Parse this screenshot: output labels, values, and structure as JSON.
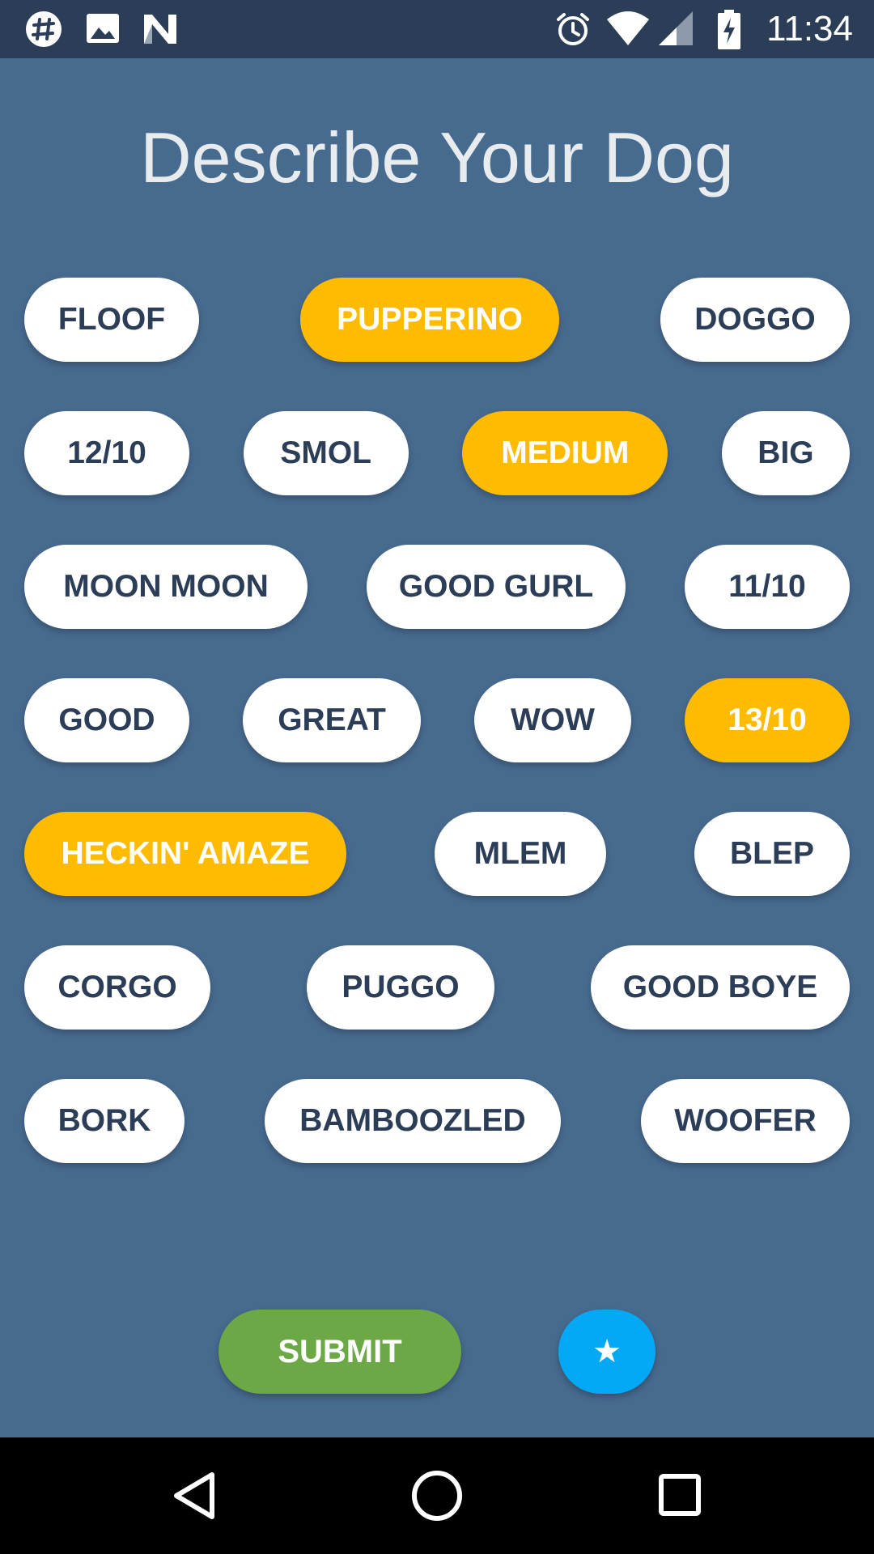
{
  "status_bar": {
    "time": "11:34",
    "left_icons": [
      "slack-icon",
      "image-icon",
      "n-icon"
    ],
    "right_icons": [
      "alarm-icon",
      "wifi-icon",
      "signal-icon",
      "battery-charging-icon"
    ]
  },
  "page": {
    "title": "Describe Your Dog"
  },
  "colors": {
    "background": "#476a8f",
    "status_bar": "#2c3e57",
    "chip": "#ffffff",
    "chip_text": "#2c3e57",
    "chip_selected": "#ffbb00",
    "submit": "#6ca846",
    "fab": "#03a9f4"
  },
  "chips": {
    "r1": [
      {
        "label": "FLOOF",
        "selected": false
      },
      {
        "label": "PUPPERINO",
        "selected": true
      },
      {
        "label": "DOGGO",
        "selected": false
      }
    ],
    "r2": [
      {
        "label": "12/10",
        "selected": false
      },
      {
        "label": "SMOL",
        "selected": false
      },
      {
        "label": "MEDIUM",
        "selected": true
      },
      {
        "label": "BIG",
        "selected": false
      }
    ],
    "r3": [
      {
        "label": "MOON MOON",
        "selected": false
      },
      {
        "label": "GOOD GURL",
        "selected": false
      },
      {
        "label": "11/10",
        "selected": false
      }
    ],
    "r4": [
      {
        "label": "GOOD",
        "selected": false
      },
      {
        "label": "GREAT",
        "selected": false
      },
      {
        "label": "WOW",
        "selected": false
      },
      {
        "label": "13/10",
        "selected": true
      }
    ],
    "r5": [
      {
        "label": "HECKIN' AMAZE",
        "selected": true
      },
      {
        "label": "MLEM",
        "selected": false
      },
      {
        "label": "BLEP",
        "selected": false
      }
    ],
    "r6": [
      {
        "label": "CORGO",
        "selected": false
      },
      {
        "label": "PUGGO",
        "selected": false
      },
      {
        "label": "GOOD BOYE",
        "selected": false
      }
    ],
    "r7": [
      {
        "label": "BORK",
        "selected": false
      },
      {
        "label": "BAMBOOZLED",
        "selected": false
      },
      {
        "label": "WOOFER",
        "selected": false
      }
    ]
  },
  "actions": {
    "submit_label": "SUBMIT",
    "fab_glyph": "★",
    "fab_icon": "star-icon"
  },
  "nav_bar": {
    "buttons": [
      "back-icon",
      "home-icon",
      "recents-icon"
    ]
  }
}
